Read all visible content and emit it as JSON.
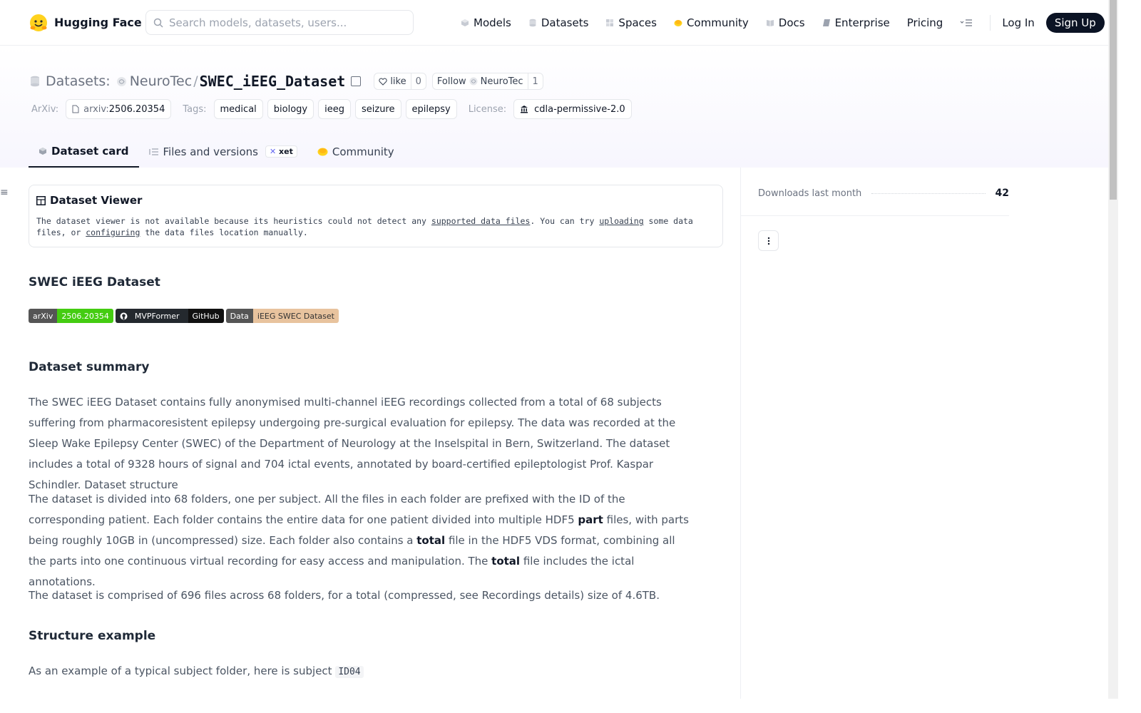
{
  "nav": {
    "brand": "Hugging Face",
    "search_placeholder": "Search models, datasets, users...",
    "items": [
      {
        "label": "Models",
        "icon": "cube-icon"
      },
      {
        "label": "Datasets",
        "icon": "database-icon"
      },
      {
        "label": "Spaces",
        "icon": "spaces-icon"
      },
      {
        "label": "Community",
        "icon": "community-icon"
      },
      {
        "label": "Docs",
        "icon": "book-icon"
      },
      {
        "label": "Enterprise",
        "icon": "enterprise-icon"
      },
      {
        "label": "Pricing"
      }
    ],
    "login": "Log In",
    "signup": "Sign Up"
  },
  "header": {
    "prefix": "Datasets:",
    "org": "NeuroTec",
    "slash": "/",
    "repo": "SWEC_iEEG_Dataset",
    "like_label": "like",
    "like_count": "0",
    "follow_label": "Follow",
    "follow_org": "NeuroTec",
    "follow_count": "1"
  },
  "meta": {
    "arxiv_label": "ArXiv:",
    "arxiv_prefix": "arxiv:",
    "arxiv_id": "2506.20354",
    "tags_label": "Tags:",
    "tags": [
      "medical",
      "biology",
      "ieeg",
      "seizure",
      "epilepsy"
    ],
    "license_label": "License:",
    "license": "cdla-permissive-2.0"
  },
  "tabs": [
    {
      "label": "Dataset card"
    },
    {
      "label": "Files and versions",
      "badge": "xet"
    },
    {
      "label": "Community"
    }
  ],
  "viewer": {
    "title": "Dataset Viewer",
    "text_1": "The dataset viewer is not available because its heuristics could not detect any ",
    "link_supported": "supported data files",
    "text_2": ". You can try ",
    "link_uploading": "uploading",
    "text_3": " some data files, or ",
    "link_configuring": "configuring",
    "text_4": " the data files location manually."
  },
  "content": {
    "title": "SWEC iEEG Dataset",
    "badges": [
      {
        "left": "arXiv",
        "right": "2506.20354"
      },
      {
        "left": "MVPFormer",
        "right": "GitHub"
      },
      {
        "left": "Data",
        "right": "iEEG SWEC Dataset"
      }
    ],
    "summary_heading": "Dataset summary",
    "summary_p1": "The SWEC iEEG Dataset contains fully anonymised multi-channel iEEG recordings collected from a total of 68 subjects suffering from pharmacoresistent epilepsy undergoing pre-surgical evaluation for epilepsy. The data was recorded at the Sleep Wake Epilepsy Center (SWEC) of the Department of Neurology at the Inselspital in Bern, Switzerland. The dataset includes a total of 9328 hours of signal and 704 ictal events, annotated by board-certified epileptologist Prof. Kaspar Schindler. Dataset structure",
    "p2_a": "The dataset is divided into 68 folders, one per subject. All the files in each folder are prefixed with the ID of the corresponding patient. Each folder contains the entire data for one patient divided into multiple HDF5 ",
    "p2_part": "part",
    "p2_b": " files, with parts being roughly 10GB in (uncompressed) size. Each folder also contains a ",
    "p2_total1": "total",
    "p2_c": " file in the HDF5 VDS format, combining all the parts into one continuous virtual recording for easy access and manipulation. The ",
    "p2_total2": "total",
    "p2_d": " file includes the ictal annotations.",
    "p3": "The dataset is comprised of 696 files across 68 folders, for a total (compressed, see Recordings details) size of 4.6TB.",
    "structure_heading": "Structure example",
    "p4": "As an example of a typical subject folder, here is subject ",
    "p4_code": "ID04"
  },
  "sidebar": {
    "downloads_label": "Downloads last month",
    "downloads_value": "42"
  }
}
